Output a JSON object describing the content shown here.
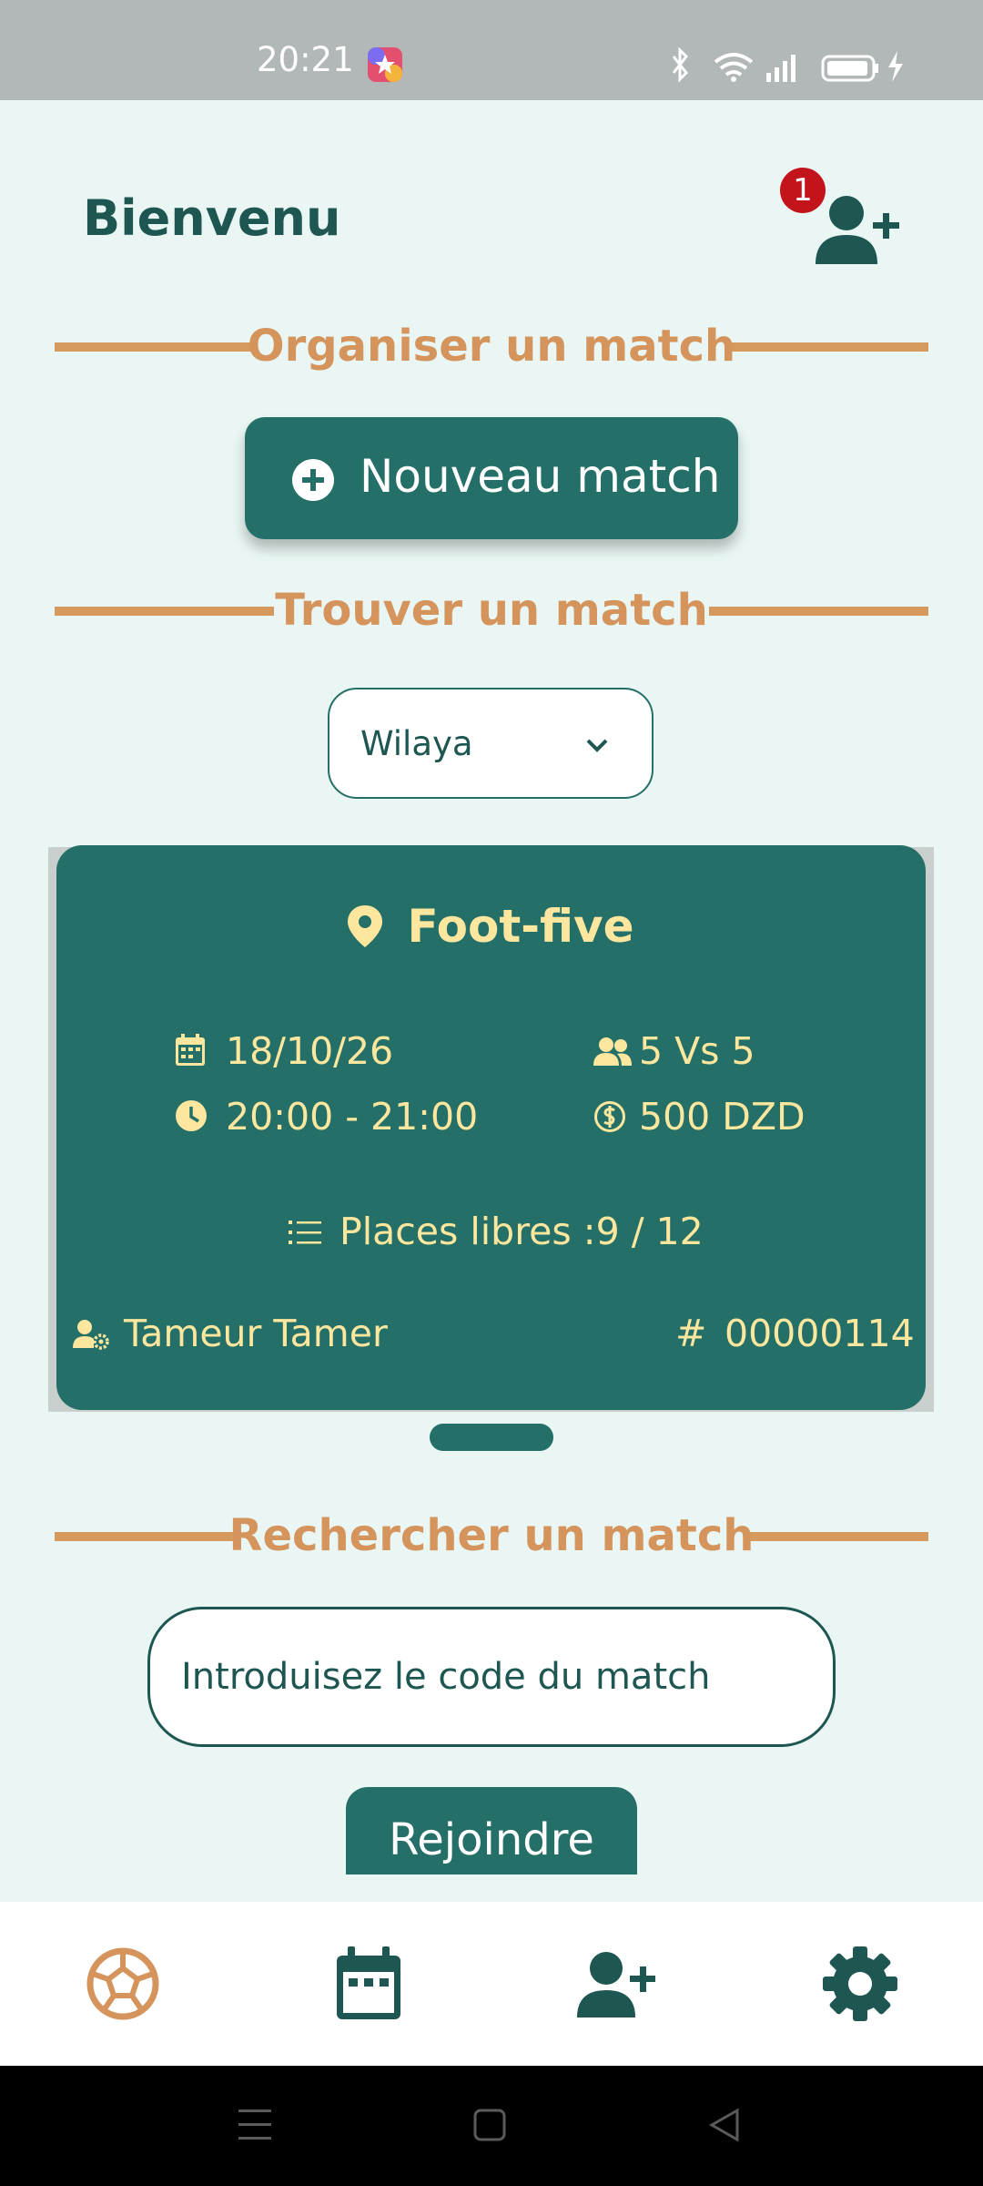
{
  "status_bar": {
    "time": "20:21"
  },
  "header": {
    "title": "Bienvenu",
    "notification_count": "1"
  },
  "sections": {
    "organize": "Organiser un match",
    "find": "Trouver un match",
    "search": "Rechercher un match"
  },
  "new_match_button": {
    "label": "Nouveau match"
  },
  "wilaya_select": {
    "value": "Wilaya"
  },
  "match_card": {
    "name": "Foot-five",
    "date": "18/10/26",
    "time": "20:00 - 21:00",
    "format": "5 Vs 5",
    "price": "500 DZD",
    "places": "Places libres :9 / 12",
    "organizer": "Tameur Tamer",
    "code": "00000114"
  },
  "search": {
    "placeholder": "Introduisez le code du match"
  },
  "join_button": {
    "label": "Rejoindre"
  },
  "bottom_nav": {
    "items": [
      {
        "icon": "soccer-ball-icon",
        "active": true
      },
      {
        "icon": "calendar-icon",
        "active": false
      },
      {
        "icon": "add-friend-icon",
        "active": false
      },
      {
        "icon": "settings-icon",
        "active": false
      }
    ]
  },
  "colors": {
    "primary": "#246f68",
    "accent": "#d4945c",
    "card_text": "#fde79f",
    "background": "#e9f6f3",
    "badge": "#c3141c"
  }
}
